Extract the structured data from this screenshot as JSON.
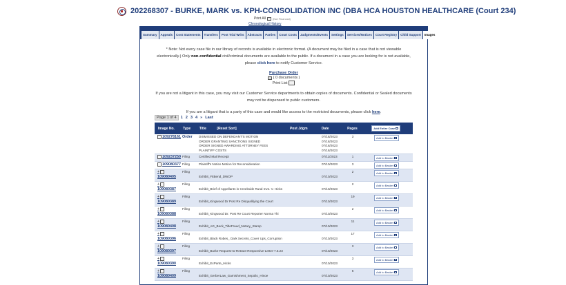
{
  "header": {
    "title": "202268307 - BURKE, MARK vs. KPH-CONSOLIDATION INC (DBA HCA HOUSTON HEALTHCARE (Court 234)",
    "print_label": "Print All",
    "print_note": "(Not Financial)",
    "chrono_link": "Chronological History"
  },
  "tabs": [
    "Summary",
    "Appeals",
    "Cost Statements",
    "Transfers",
    "Post Trial Writs",
    "Abstracts",
    "Parties",
    "Court Costs",
    "Judgments/Events",
    "Settings",
    "Services/Notices",
    "Court Registry",
    "Child Support",
    "Images"
  ],
  "active_tab": "Images",
  "notice": {
    "part1": "* Note: Not every case file in our library of records is available in electronic format. (A document may be filed in a case that is not viewable electronically.) Only ",
    "bold": "non-confidential",
    "part2": " civil/criminal documents are available to the public. If a document in a case you are looking for is not available, please ",
    "link": "click here",
    "part3": " to notify Customer Service."
  },
  "purchase": {
    "label": "Purchase Order",
    "docs": "( 0 documents )",
    "print_list": "Print List"
  },
  "para1": "If you are not a litigant in this case, you may visit our Customer Service departments to obtain copies of documents. Confidential or Sealed documents may not be dispensed to public customers.",
  "para2": {
    "text": "If you are a litigant that is a party of this case and would like access to the restricted documents, please click ",
    "link": "here",
    "end": "."
  },
  "pager": {
    "current": "Page 1 of 4",
    "pages": [
      "1",
      "2",
      "3",
      "4",
      "»",
      "Last"
    ]
  },
  "table": {
    "headers": {
      "image_no": "Image No.",
      "type": "Type",
      "title": "Title",
      "reset": "[Reset Sort]",
      "post_jdgm": "Post Jdgm",
      "date": "Date",
      "pages": "Pages",
      "add_entire": "Add Entire Case"
    },
    "add_label": "Add to Basket",
    "rows": [
      {
        "image_no": "109278161",
        "type": "Order",
        "titles": [
          "DISMISSED ON DEFENDANT'S MOTION",
          "ORDER GRANTING SANCTIONS SIGNED",
          "ORDER SIGNED AWARDING ATTORNEY FEES",
          "PLAINTIFF COSTS"
        ],
        "dates": [
          "07/18/2023",
          "07/18/2023",
          "07/18/2023",
          "07/18/2023"
        ],
        "pages": "3"
      },
      {
        "image_no": "109237250",
        "type": "Filing",
        "titles": [
          "Certified Mail Receipt"
        ],
        "dates": [
          "07/11/2023"
        ],
        "pages": "1"
      },
      {
        "image_no": "109080377",
        "type": "Filing",
        "titles": [
          "Plaintiff's Notice Motion for Reconsideration"
        ],
        "dates": [
          "07/10/2023"
        ],
        "pages": "3"
      },
      {
        "image_no": "109080405",
        "type": "Filing",
        "titles": [
          "Exhibit_FitBend_DWOP"
        ],
        "dates": [
          "07/10/2023"
        ],
        "pages": "2"
      },
      {
        "image_no": "109080387",
        "type": "Filing",
        "titles": [
          "Exhibit_Brief of Appellants in Creekside Rural Invs. V. Hicks"
        ],
        "dates": [
          "07/10/2023"
        ],
        "pages": "2"
      },
      {
        "image_no": "109080389",
        "type": "Filing",
        "titles": [
          "Exhibit_Kingwood Dr Post Re Disqualifying the Court"
        ],
        "dates": [
          "07/10/2023"
        ],
        "pages": "19"
      },
      {
        "image_no": "109080388",
        "type": "Filing",
        "titles": [
          "Exhibit_Kingwood Dr. Post Re Court Reporter Norma Thi"
        ],
        "dates": [
          "07/10/2023"
        ],
        "pages": "2"
      },
      {
        "image_no": "109080408",
        "type": "Filing",
        "titles": [
          "Exhibit_AG_Beck_TitleFraud_Notary_Stamp"
        ],
        "dates": [
          "07/10/2023"
        ],
        "pages": "11"
      },
      {
        "image_no": "109080396",
        "type": "Filing",
        "titles": [
          "Exhibit_Black Robes_ Dark Secrets_Cover Ups_Corruption"
        ],
        "dates": [
          "07/10/2023"
        ],
        "pages": "17"
      },
      {
        "image_no": "109080397",
        "type": "Filing",
        "titles": [
          "Exhibit_Burke-Request-to-Retract-Responsive-Letter-7.5.23"
        ],
        "dates": [
          "07/10/2023"
        ],
        "pages": "3"
      },
      {
        "image_no": "109080390",
        "type": "Filing",
        "titles": [
          "Exhibit_ExParte_Hicks"
        ],
        "dates": [
          "07/10/2023"
        ],
        "pages": "3"
      },
      {
        "image_no": "109080409",
        "type": "Filing",
        "titles": [
          "Exhibit_GerberLaw_Garnishment_Sepolio_Hinoe"
        ],
        "dates": [
          "07/10/2023"
        ],
        "pages": "6"
      }
    ]
  }
}
